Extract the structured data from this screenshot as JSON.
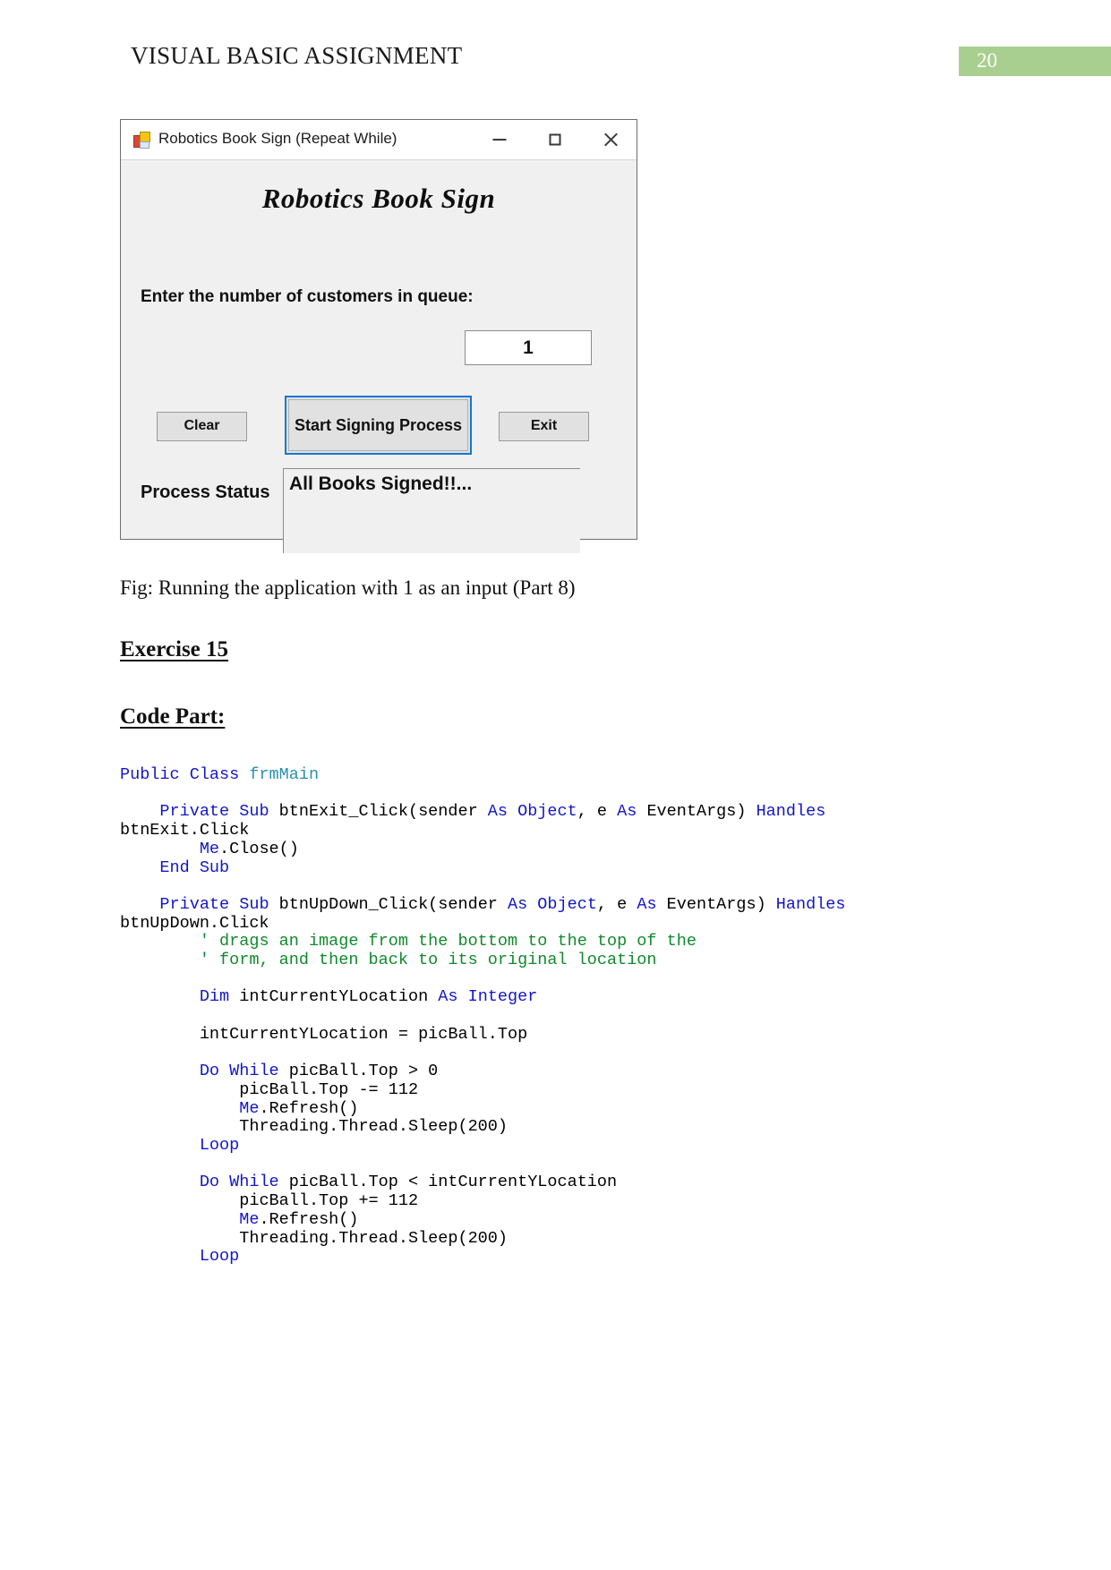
{
  "header": {
    "title": "VISUAL BASIC ASSIGNMENT",
    "page_number": "20",
    "badge_color": "#a8cf8f"
  },
  "vb_form": {
    "window_title": "Robotics Book Sign (Repeat While)",
    "app_icon": "vb-form-icon",
    "window_controls": {
      "minimize": "minimize-icon",
      "maximize": "maximize-icon",
      "close": "close-icon"
    },
    "form_heading": "Robotics Book Sign",
    "queue_label": "Enter the number of customers in queue:",
    "queue_value": "1",
    "queue_placeholder": "",
    "buttons": {
      "clear": "Clear",
      "start": "Start Signing Process",
      "exit": "Exit",
      "focus_color": "#1577cf"
    },
    "status_label": "Process Status",
    "status_value": "All Books Signed!!..."
  },
  "document": {
    "figure_caption": "Fig: Running the application with 1 as an input (Part 8)",
    "exercise_heading": "Exercise 15",
    "code_heading": "Code Part:"
  },
  "code": {
    "lines": [
      [
        {
          "t": "Public Class ",
          "c": "kw"
        },
        {
          "t": "frmMain",
          "c": "typ"
        }
      ],
      [],
      [
        {
          "t": "    ",
          "c": "nrm"
        },
        {
          "t": "Private Sub ",
          "c": "kw"
        },
        {
          "t": "btnExit_Click(sender ",
          "c": "nrm"
        },
        {
          "t": "As Object",
          "c": "kw"
        },
        {
          "t": ", e ",
          "c": "nrm"
        },
        {
          "t": "As ",
          "c": "kw"
        },
        {
          "t": "EventArgs) ",
          "c": "nrm"
        },
        {
          "t": "Handles",
          "c": "kw"
        }
      ],
      [
        {
          "t": "btnExit.Click",
          "c": "nrm"
        }
      ],
      [
        {
          "t": "        ",
          "c": "nrm"
        },
        {
          "t": "Me",
          "c": "kw"
        },
        {
          "t": ".Close()",
          "c": "nrm"
        }
      ],
      [
        {
          "t": "    ",
          "c": "nrm"
        },
        {
          "t": "End Sub",
          "c": "kw"
        }
      ],
      [],
      [
        {
          "t": "    ",
          "c": "nrm"
        },
        {
          "t": "Private Sub ",
          "c": "kw"
        },
        {
          "t": "btnUpDown_Click(sender ",
          "c": "nrm"
        },
        {
          "t": "As Object",
          "c": "kw"
        },
        {
          "t": ", e ",
          "c": "nrm"
        },
        {
          "t": "As ",
          "c": "kw"
        },
        {
          "t": "EventArgs) ",
          "c": "nrm"
        },
        {
          "t": "Handles",
          "c": "kw"
        }
      ],
      [
        {
          "t": "btnUpDown.Click",
          "c": "nrm"
        }
      ],
      [
        {
          "t": "        ",
          "c": "nrm"
        },
        {
          "t": "' drags an image from the bottom to the top of the",
          "c": "cmt"
        }
      ],
      [
        {
          "t": "        ",
          "c": "nrm"
        },
        {
          "t": "' form, and then back to its original location",
          "c": "cmt"
        }
      ],
      [],
      [
        {
          "t": "        ",
          "c": "nrm"
        },
        {
          "t": "Dim ",
          "c": "kw"
        },
        {
          "t": "intCurrentYLocation ",
          "c": "nrm"
        },
        {
          "t": "As Integer",
          "c": "kw"
        }
      ],
      [],
      [
        {
          "t": "        intCurrentYLocation = picBall.Top",
          "c": "nrm"
        }
      ],
      [],
      [
        {
          "t": "        ",
          "c": "nrm"
        },
        {
          "t": "Do While ",
          "c": "kw"
        },
        {
          "t": "picBall.Top > 0",
          "c": "nrm"
        }
      ],
      [
        {
          "t": "            picBall.Top -= 112",
          "c": "nrm"
        }
      ],
      [
        {
          "t": "            ",
          "c": "nrm"
        },
        {
          "t": "Me",
          "c": "kw"
        },
        {
          "t": ".Refresh()",
          "c": "nrm"
        }
      ],
      [
        {
          "t": "            Threading.Thread.Sleep(200)",
          "c": "nrm"
        }
      ],
      [
        {
          "t": "        ",
          "c": "nrm"
        },
        {
          "t": "Loop",
          "c": "kw"
        }
      ],
      [],
      [
        {
          "t": "        ",
          "c": "nrm"
        },
        {
          "t": "Do While ",
          "c": "kw"
        },
        {
          "t": "picBall.Top < intCurrentYLocation",
          "c": "nrm"
        }
      ],
      [
        {
          "t": "            picBall.Top += 112",
          "c": "nrm"
        }
      ],
      [
        {
          "t": "            ",
          "c": "nrm"
        },
        {
          "t": "Me",
          "c": "kw"
        },
        {
          "t": ".Refresh()",
          "c": "nrm"
        }
      ],
      [
        {
          "t": "            Threading.Thread.Sleep(200)",
          "c": "nrm"
        }
      ],
      [
        {
          "t": "        ",
          "c": "nrm"
        },
        {
          "t": "Loop",
          "c": "kw"
        }
      ]
    ]
  }
}
